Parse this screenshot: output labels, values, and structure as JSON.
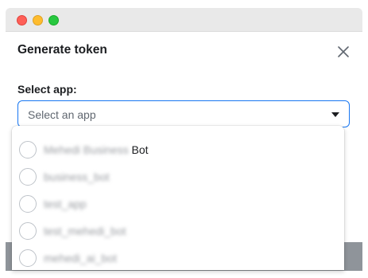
{
  "dialog": {
    "title": "Generate token",
    "field_label": "Select app:",
    "select": {
      "placeholder": "Select an app"
    }
  },
  "icons": {
    "close": "close-icon",
    "caret": "chevron-down-icon"
  },
  "colors": {
    "accent": "#1877f2",
    "text": "#1c1e21"
  },
  "options": [
    {
      "blurred": "Mehedi Business",
      "text": "Bot"
    },
    {
      "blurred": "business_bot",
      "text": ""
    },
    {
      "blurred": "test_app",
      "text": ""
    },
    {
      "blurred": "test_mehedi_bot",
      "text": ""
    },
    {
      "blurred": "mehedi_ai_bot",
      "text": ""
    }
  ]
}
